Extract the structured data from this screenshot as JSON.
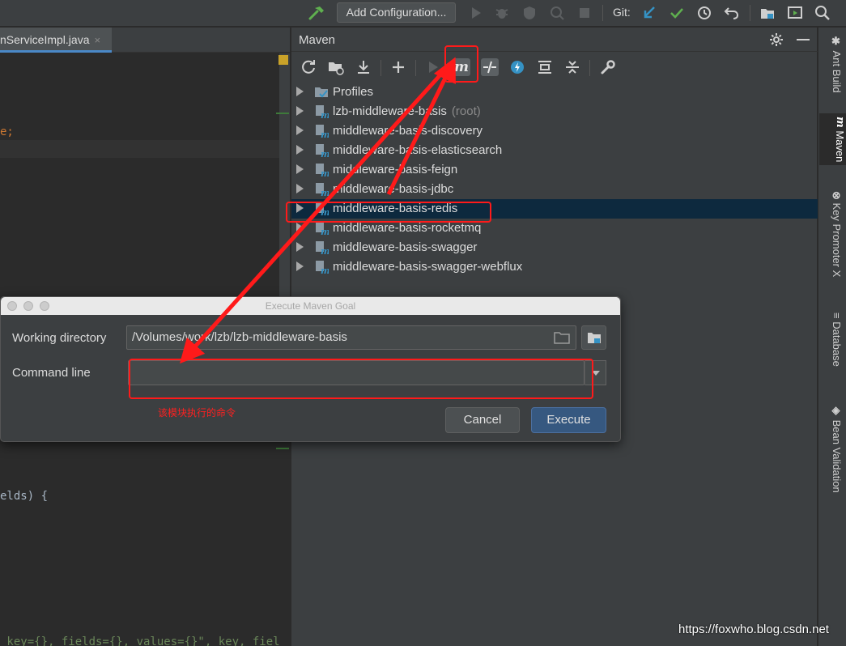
{
  "toolbar": {
    "add_configuration": "Add Configuration...",
    "git_label": "Git:",
    "colors": {
      "check": "#5fb04f",
      "update": "#3592c4",
      "hammer": "#5fb04f"
    }
  },
  "editor": {
    "tab_label": "nServiceImpl.java",
    "tab_close": "×",
    "lines": [
      {
        "text": "e;"
      },
      {
        "text": "elds) {"
      },
      {
        "text": " key={}, fields={}, values={}\", key, fiel"
      }
    ]
  },
  "maven": {
    "title": "Maven",
    "tree": [
      {
        "label": "Profiles",
        "suffix": "",
        "icon": "profiles-icon"
      },
      {
        "label": "lzb-middleware-basis",
        "suffix": "(root)",
        "icon": "maven-module-icon"
      },
      {
        "label": "middleware-basis-discovery",
        "suffix": "",
        "icon": "maven-module-icon"
      },
      {
        "label": "middleware-basis-elasticsearch",
        "suffix": "",
        "icon": "maven-module-icon"
      },
      {
        "label": "middleware-basis-feign",
        "suffix": "",
        "icon": "maven-module-icon"
      },
      {
        "label": "middleware-basis-jdbc",
        "suffix": "",
        "icon": "maven-module-icon"
      },
      {
        "label": "middleware-basis-redis",
        "suffix": "",
        "icon": "maven-module-icon",
        "selected": true
      },
      {
        "label": "middleware-basis-rocketmq",
        "suffix": "",
        "icon": "maven-module-icon"
      },
      {
        "label": "middleware-basis-swagger",
        "suffix": "",
        "icon": "maven-module-icon"
      },
      {
        "label": "middleware-basis-swagger-webflux",
        "suffix": "",
        "icon": "maven-module-icon"
      }
    ]
  },
  "right_strip": {
    "tabs": [
      "Ant Build",
      "Maven",
      "Key Promoter X",
      "Database",
      "Bean Validation"
    ]
  },
  "dialog": {
    "title": "Execute Maven Goal",
    "working_directory_label": "Working directory",
    "working_directory_value": "/Volumes/work/lzb/lzb-middleware-basis",
    "command_line_label": "Command line",
    "command_line_value": "",
    "cancel_label": "Cancel",
    "execute_label": "Execute"
  },
  "annotation": {
    "note": "该模块执行的命令",
    "color": "#ff1a1a"
  },
  "watermark": "https://foxwho.blog.csdn.net"
}
